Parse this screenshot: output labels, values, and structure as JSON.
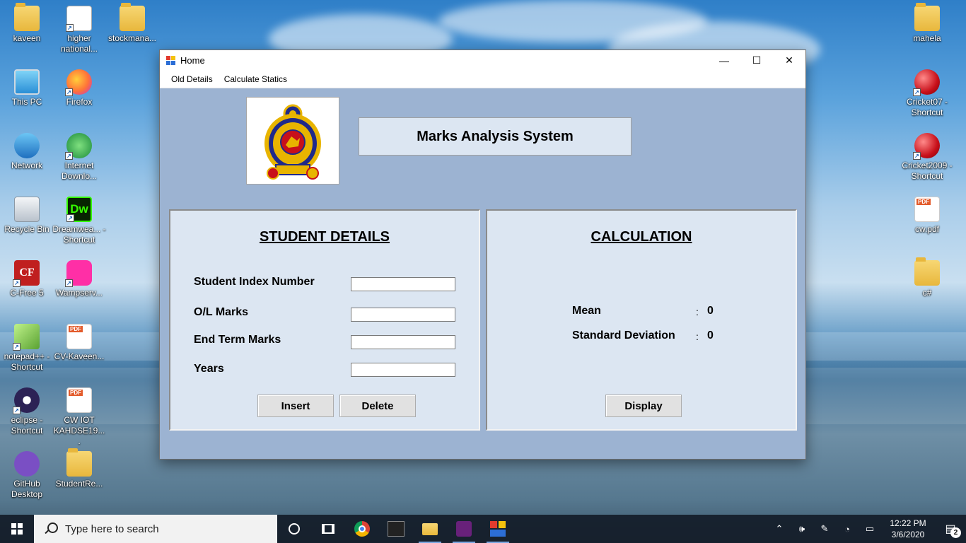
{
  "desktop": {
    "left_icons": [
      {
        "label": "kaveen",
        "icon": "user-folder-icon"
      },
      {
        "label": "higher national...",
        "icon": "document-shortcut-icon"
      },
      {
        "label": "stockmana...",
        "icon": "vs-folder-icon"
      },
      {
        "label": "This PC",
        "icon": "this-pc-icon"
      },
      {
        "label": "Firefox",
        "icon": "firefox-icon"
      },
      {
        "label": "Network",
        "icon": "network-icon"
      },
      {
        "label": "Internet Downlo...",
        "icon": "idm-icon"
      },
      {
        "label": "Recycle Bin",
        "icon": "recycle-bin-icon"
      },
      {
        "label": "Dreamwea... - Shortcut",
        "icon": "dreamweaver-icon"
      },
      {
        "label": "C-Free 5",
        "icon": "cfree-icon"
      },
      {
        "label": "Wampserv...",
        "icon": "wampserver-icon"
      },
      {
        "label": "notepad++ - Shortcut",
        "icon": "notepadpp-icon"
      },
      {
        "label": "CV-Kaveen...",
        "icon": "pdf-icon"
      },
      {
        "label": "eclipse - Shortcut",
        "icon": "eclipse-icon"
      },
      {
        "label": "CW IOT KAHDSE19....",
        "icon": "pdf-icon"
      },
      {
        "label": "GitHub Desktop",
        "icon": "github-icon"
      },
      {
        "label": "StudentRe...",
        "icon": "folder-icon"
      }
    ],
    "right_icons": [
      {
        "label": "mahela",
        "icon": "folder-icon"
      },
      {
        "label": "Cricket07 - Shortcut",
        "icon": "cricket-ball-icon"
      },
      {
        "label": "Cricket2009 - Shortcut",
        "icon": "cricket-ball-icon"
      },
      {
        "label": "cw.pdf",
        "icon": "pdf-icon"
      },
      {
        "label": "c#",
        "icon": "folder-icon"
      }
    ]
  },
  "window": {
    "title": "Home",
    "controls": {
      "minimize": "—",
      "maximize": "☐",
      "close": "✕"
    },
    "menu": [
      "Old Details",
      "Calculate Statics"
    ],
    "header_title": "Marks Analysis System",
    "student_panel": {
      "heading": "STUDENT DETAILS",
      "fields": [
        {
          "label": "Student Index Number",
          "value": ""
        },
        {
          "label": "O/L Marks",
          "value": ""
        },
        {
          "label": "End Term Marks",
          "value": ""
        },
        {
          "label": "Years",
          "value": ""
        }
      ],
      "insert_label": "Insert",
      "delete_label": "Delete"
    },
    "calc_panel": {
      "heading": "CALCULATION",
      "mean_label": "Mean",
      "mean_colon": ":",
      "mean_value": "0",
      "sd_label": "Standard Deviation",
      "sd_colon": ":",
      "sd_value": "0",
      "display_label": "Display"
    }
  },
  "taskbar": {
    "search_placeholder": "Type here to search",
    "apps": [
      "cortana-icon",
      "task-view-icon",
      "chrome-icon",
      "app-icon",
      "file-explorer-icon",
      "visual-studio-icon",
      "winforms-app-icon"
    ],
    "time": "12:22 PM",
    "date": "3/6/2020",
    "notification_count": "2"
  },
  "colors": {
    "window_bg": "#9cb3d2",
    "panel_bg": "#dce6f2",
    "taskbar_bg": "#141c28"
  }
}
